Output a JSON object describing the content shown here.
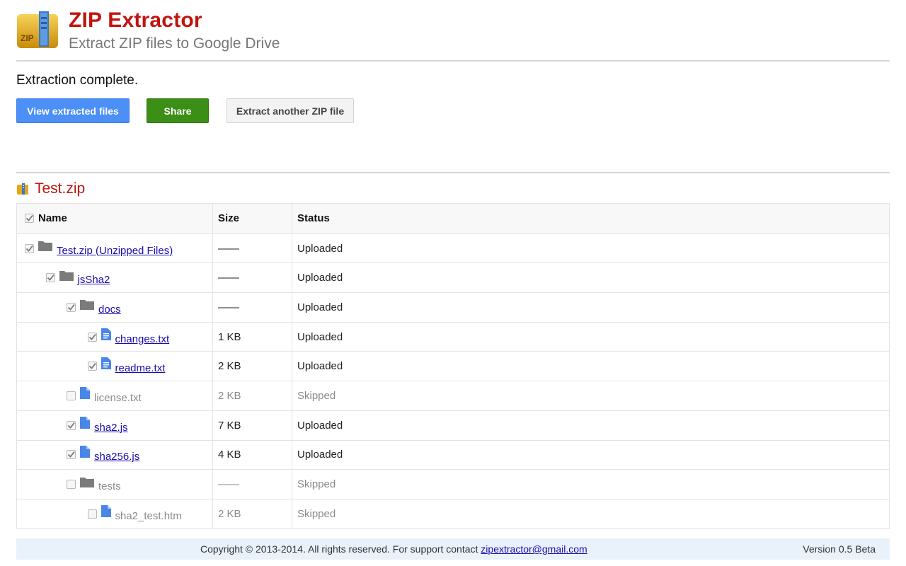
{
  "header": {
    "title": "ZIP Extractor",
    "subtitle": "Extract ZIP files to Google Drive",
    "logo_text": "ZIP"
  },
  "status_message": "Extraction complete.",
  "buttons": {
    "view": "View extracted files",
    "share": "Share",
    "extract_another": "Extract another ZIP file"
  },
  "zip_file": {
    "name": "Test.zip"
  },
  "table": {
    "columns": [
      "Name",
      "Size",
      "Status"
    ],
    "rows": [
      {
        "name": "Test.zip (Unzipped Files)",
        "size": "——",
        "status": "Uploaded",
        "type": "folder",
        "depth": 0,
        "checked": true,
        "link": true
      },
      {
        "name": "jsSha2",
        "size": "——",
        "status": "Uploaded",
        "type": "folder",
        "depth": 1,
        "checked": true,
        "link": true
      },
      {
        "name": "docs",
        "size": "——",
        "status": "Uploaded",
        "type": "folder",
        "depth": 2,
        "checked": true,
        "link": true
      },
      {
        "name": "changes.txt",
        "size": "1 KB",
        "status": "Uploaded",
        "type": "text",
        "depth": 3,
        "checked": true,
        "link": true
      },
      {
        "name": "readme.txt",
        "size": "2 KB",
        "status": "Uploaded",
        "type": "text",
        "depth": 3,
        "checked": true,
        "link": true
      },
      {
        "name": "license.txt",
        "size": "2 KB",
        "status": "Skipped",
        "type": "file",
        "depth": 2,
        "checked": false,
        "link": false
      },
      {
        "name": "sha2.js",
        "size": "7 KB",
        "status": "Uploaded",
        "type": "file",
        "depth": 2,
        "checked": true,
        "link": true
      },
      {
        "name": "sha256.js",
        "size": "4 KB",
        "status": "Uploaded",
        "type": "file",
        "depth": 2,
        "checked": true,
        "link": true
      },
      {
        "name": "tests",
        "size": "——",
        "status": "Skipped",
        "type": "folder",
        "depth": 2,
        "checked": false,
        "link": false
      },
      {
        "name": "sha2_test.htm",
        "size": "2 KB",
        "status": "Skipped",
        "type": "file",
        "depth": 3,
        "checked": false,
        "link": false
      }
    ]
  },
  "footer": {
    "copyright": "Copyright © 2013-2014. All rights reserved. For support contact",
    "email": "zipextractor@gmail.com",
    "version": "Version 0.5 Beta"
  },
  "colors": {
    "brand_red": "#c1140e",
    "primary_blue": "#4b8ff7",
    "share_green": "#3b8e16",
    "link": "#1a0dab"
  }
}
